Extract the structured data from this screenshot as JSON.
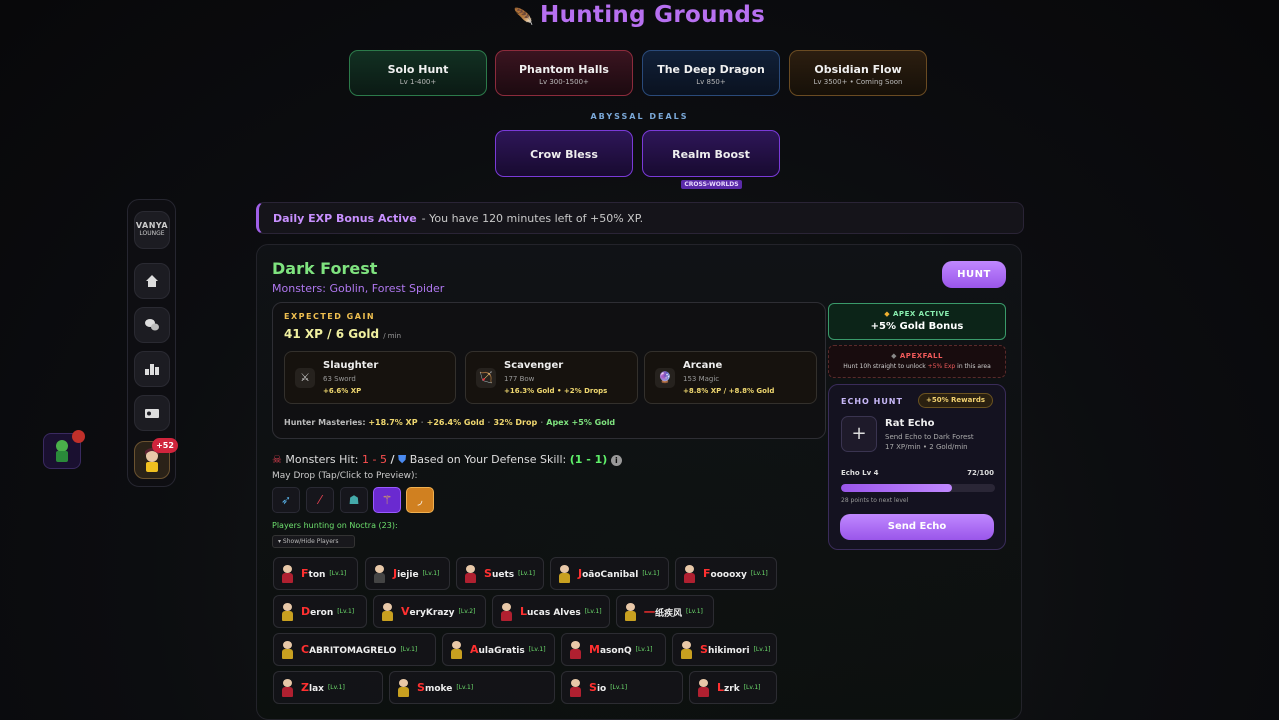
{
  "header": {
    "icon": "🪶",
    "title": "Hunting Grounds"
  },
  "zones": [
    {
      "name": "Solo Hunt",
      "sub": "Lv 1-400+"
    },
    {
      "name": "Phantom Halls",
      "sub": "Lv 300-1500+"
    },
    {
      "name": "The Deep Dragon",
      "sub": "Lv 850+"
    },
    {
      "name": "Obsidian Flow",
      "sub": "Lv 3500+ • Coming Soon"
    }
  ],
  "deals": {
    "label": "ABYSSAL DEALS",
    "items": [
      {
        "name": "Crow Bless"
      },
      {
        "name": "Realm Boost"
      }
    ],
    "cross_badge": "CROSS-WORLDS"
  },
  "sidebar": {
    "logo_top": "VANYA",
    "logo_bottom": "LOUNGE",
    "items": [
      {
        "icon": "home-icon",
        "glyph": "⌂"
      },
      {
        "icon": "chat-icon",
        "glyph": "💬"
      },
      {
        "icon": "leaderboard-icon",
        "glyph": "▙"
      },
      {
        "icon": "ticket-icon",
        "glyph": "🎟"
      }
    ],
    "notification_badge": "+52"
  },
  "exp_banner": {
    "title": "Daily EXP Bonus Active",
    "text": "- You have 120 minutes left of +50% XP."
  },
  "area": {
    "name": "Dark Forest",
    "monsters": "Monsters: Goblin, Forest Spider",
    "hunt_label": "HUNT",
    "expected_label": "EXPECTED GAIN",
    "expected_xp": "41 XP",
    "expected_sep": "/",
    "expected_gold": "6 Gold",
    "expected_unit": "/ min"
  },
  "skills": [
    {
      "icon": "⚔",
      "name": "Slaughter",
      "level": "63 Sword",
      "bonus": "+6.6% XP"
    },
    {
      "icon": "🏹",
      "name": "Scavenger",
      "level": "177 Bow",
      "bonus": "+16.3% Gold • +2% Drops"
    },
    {
      "icon": "🔮",
      "name": "Arcane",
      "level": "153 Magic",
      "bonus": "+8.8% XP / +8.8% Gold"
    }
  ],
  "masteries": {
    "label": "Hunter Masteries:",
    "xp": "+18.7% XP",
    "gold": "+26.4% Gold",
    "drop": "32% Drop",
    "apex": "Apex +5% Gold"
  },
  "apex": {
    "label": "APEX ACTIVE",
    "value": "+5% Gold Bonus"
  },
  "apexfall": {
    "label": "APEXFALL",
    "desc_a": "Hunt 10h straight to unlock ",
    "desc_b": "+5% Exp",
    "desc_c": " in this area"
  },
  "echo": {
    "title": "ECHO HUNT",
    "rewards": "+50% Rewards",
    "name": "Rat Echo",
    "desc1": "Send Echo to Dark Forest",
    "desc2": "17 XP/min • 2 Gold/min",
    "level": "Echo Lv 4",
    "xp": "72/100",
    "progress": 0.72,
    "next": "28 points to next level",
    "send_label": "Send Echo"
  },
  "combat": {
    "monsters_hit_label": "Monsters Hit:",
    "hit_range": "1 - 5",
    "slash": "/",
    "defense_label": "Based on Your Defense Skill:",
    "defense_range": "(1 - 1)",
    "may_drop": "May Drop (Tap/Click to Preview):",
    "players_hunting": "Players hunting on Noctra (23):",
    "toggle": "▾ Show/Hide Players"
  },
  "players": [
    {
      "name": "Fton",
      "lv": "[Lv.1]"
    },
    {
      "name": "Jiejie",
      "lv": "[Lv.1]"
    },
    {
      "name": "Suets",
      "lv": "[Lv.1]"
    },
    {
      "name": "JoãoCanibal",
      "lv": "[Lv.1]"
    },
    {
      "name": "Fooooxy",
      "lv": "[Lv.1]"
    },
    {
      "name": "Deron",
      "lv": "[Lv.1]"
    },
    {
      "name": "VeryKrazy",
      "lv": "[Lv.2]"
    },
    {
      "name": "Lucas Alves",
      "lv": "[Lv.1]"
    },
    {
      "name": "一纸疾风",
      "lv": "[Lv.1]"
    },
    {
      "name": "CABRITOMAGRELO",
      "lv": "[Lv.1]"
    },
    {
      "name": "AulaGratis",
      "lv": "[Lv.1]"
    },
    {
      "name": "MasonQ",
      "lv": "[Lv.1]"
    },
    {
      "name": "Shikimori",
      "lv": "[Lv.1]"
    },
    {
      "name": "Zlax",
      "lv": "[Lv.1]"
    },
    {
      "name": "Smoke",
      "lv": "[Lv.1]"
    },
    {
      "name": "Sio",
      "lv": "[Lv.1]"
    },
    {
      "name": "Lzrk",
      "lv": "[Lv.1]"
    }
  ]
}
